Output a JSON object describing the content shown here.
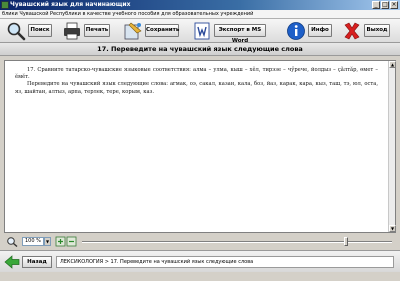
{
  "window": {
    "title": "Чувашский язык для начинающих",
    "minimize": "_",
    "maximize": "□",
    "close": "×"
  },
  "subtitle": "блики Чувашской Республики в качестве учебного пособия для образовательных учреждений",
  "toolbar": {
    "search_label": "Поиск",
    "print_label": "Печать",
    "save_label": "Сохранить",
    "export_label": "Экспорт в MS Word",
    "info_label": "Инфо",
    "exit_label": "Выход"
  },
  "heading": "17. Переведите на чувашский язык следующие слова",
  "content": {
    "para1": "17. Сравните татарско-чувашские языковые соответствия: алма – улма, кыш – хӗл, тирэзе – чӳрече, йолдыз – ҫӑлтӑр, өмет – ӗмӗт.",
    "para2": "Переведите на чувашский язык следующие слова: агмак, оэ, сакал, казан, кала, боз, йаз, карак, кара, кыз, таш, тэ, юл, оста, яз, шайтан, алтыз, арпа, терлек, тере, корым, каз."
  },
  "status": {
    "zoom": "100 %",
    "zoom_arrow": "▼"
  },
  "scroll": {
    "up": "▲",
    "down": "▼"
  },
  "navigation": {
    "back_label": "Назад",
    "breadcrumb": "ЛЕКСИКОЛОГИЯ > 17. Переведите на чувашский язык следующие слова"
  }
}
